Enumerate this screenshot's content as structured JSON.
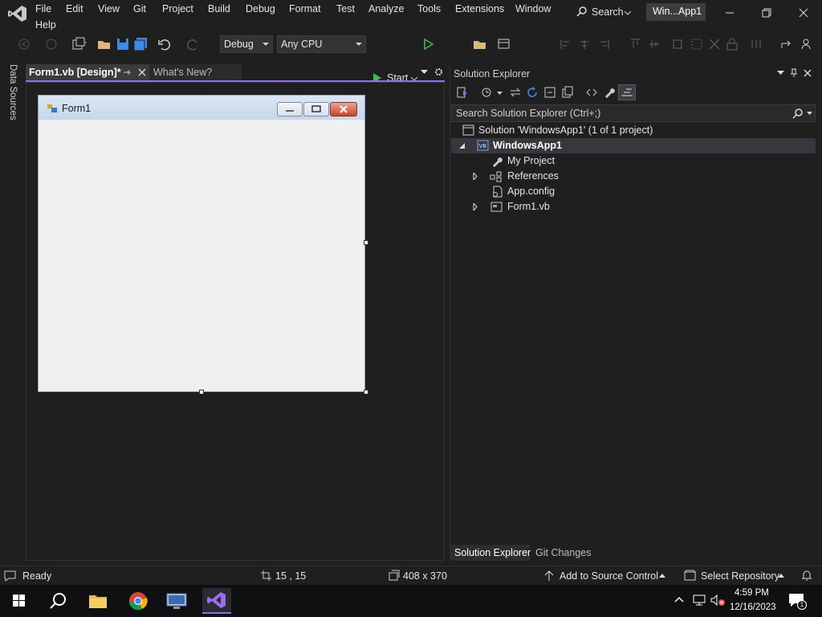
{
  "menu": {
    "row1": [
      "File",
      "Edit",
      "View",
      "Git",
      "Project",
      "Build",
      "Debug",
      "Format",
      "Test",
      "Analyze",
      "Tools",
      "Extensions",
      "Window"
    ],
    "row2": [
      "Help"
    ],
    "search_label": "Search",
    "title_badge": "Win...App1"
  },
  "toolbar": {
    "config": "Debug",
    "platform": "Any CPU",
    "start_label": "Start"
  },
  "left_rail": {
    "data_sources": "Data Sources"
  },
  "doc_tabs": {
    "active": "Form1.vb [Design]*",
    "inactive": "What's New?"
  },
  "form": {
    "title": "Form1"
  },
  "solution_explorer": {
    "title": "Solution Explorer",
    "search_placeholder": "Search Solution Explorer (Ctrl+;)",
    "solution": "Solution 'WindowsApp1' (1 of 1 project)",
    "project": "WindowsApp1",
    "items": [
      "My Project",
      "References",
      "App.config",
      "Form1.vb"
    ],
    "bottom_tabs": [
      "Solution Explorer",
      "Git Changes"
    ]
  },
  "status": {
    "ready": "Ready",
    "position": "15 , 15",
    "size": "408 x 370",
    "source_control": "Add to Source Control",
    "repository": "Select Repository"
  },
  "taskbar": {
    "time": "4:59 PM",
    "date": "12/16/2023",
    "notification_count": "1"
  },
  "colors": {
    "accent": "#8f70f2",
    "background": "#1f1f1f",
    "start_green": "#3fb950"
  }
}
